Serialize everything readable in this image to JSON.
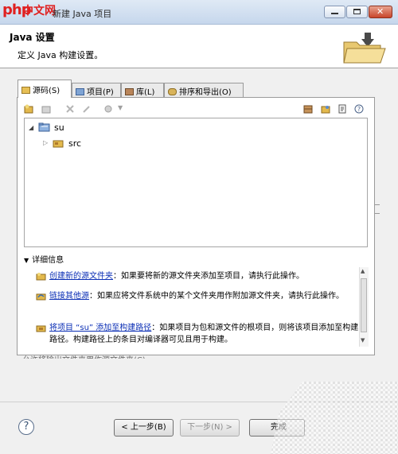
{
  "window": {
    "logo_latin": "php",
    "logo_cn": "中文网",
    "title_text": "新建 Java 项目"
  },
  "header": {
    "title": "Java 设置",
    "description": "定义 Java 构建设置。"
  },
  "tabs": [
    {
      "label": "源码(S)",
      "active": true
    },
    {
      "label": "项目(P)",
      "active": false
    },
    {
      "label": "库(L)",
      "active": false
    },
    {
      "label": "排序和导出(O)",
      "active": false
    }
  ],
  "tree": {
    "project": "su",
    "folder": "src"
  },
  "details": {
    "toggle_label": "详细信息",
    "items": [
      {
        "link": "创建新的源文件夹",
        "text": "：如果要将新的源文件夹添加至项目，请执行此操作。"
      },
      {
        "link": "链接其他源",
        "text": "：如果应将文件系统中的某个文件夹用作附加源文件夹，请执行此操作。"
      },
      {
        "link": "将项目 “su” 添加至构建路径",
        "text": "：如果项目为包和源文件的根项目，则将该项目添加至构建路径。构建路径上的条目对编译器可见且用于构建。"
      }
    ],
    "truncated": "允许将输出文件夹用作源文件夹(C)"
  },
  "buttons": {
    "help": "?",
    "back": "< 上一步(B)",
    "next": "下一步(N) >",
    "finish": "完成"
  },
  "colors": {
    "link": "#0a2eb5",
    "logo": "#e02020",
    "close_button": "#c8452b"
  }
}
